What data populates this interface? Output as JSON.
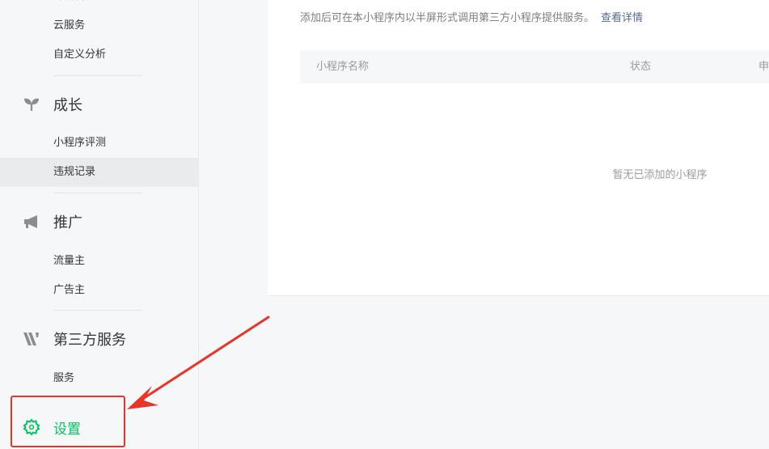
{
  "sidebar": {
    "partial_top": "开发管理",
    "dev_items": [
      "云服务",
      "自定义分析"
    ],
    "groups": [
      {
        "label": "成长",
        "icon": "sprout-icon",
        "items": [
          "小程序评测",
          "违规记录"
        ]
      },
      {
        "label": "推广",
        "icon": "megaphone-icon",
        "items": [
          "流量主",
          "广告主"
        ]
      },
      {
        "label": "第三方服务",
        "icon": "third-party-icon",
        "items": [
          "服务"
        ]
      }
    ],
    "settings": {
      "label": "设置",
      "icon": "gear-icon",
      "color": "#07c160"
    }
  },
  "main": {
    "description": "添加后可在本小程序内以半屏形式调用第三方小程序提供服务。",
    "detail_link": "查看详情",
    "table": {
      "columns": [
        "小程序名称",
        "状态",
        "申"
      ],
      "empty_text": "暂无已添加的小程序"
    }
  },
  "annotation": {
    "color": "#e8352a"
  }
}
